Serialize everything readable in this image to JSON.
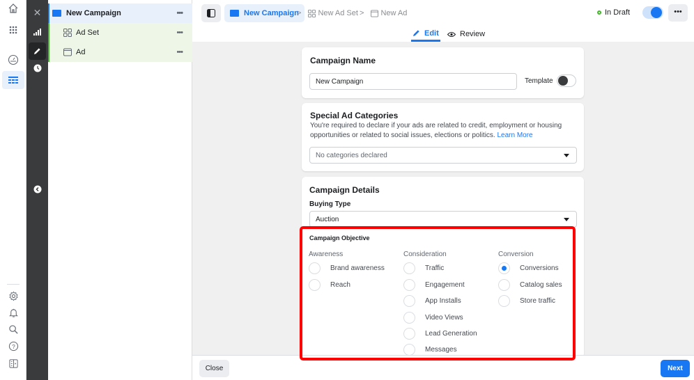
{
  "left_rail": {
    "top_icons": [
      "home-icon",
      "apps-grid-icon",
      "dashboard-gauge-icon",
      "ads-manager-table-icon"
    ],
    "bottom_icons": [
      "settings-icon",
      "notifications-icon",
      "search-icon",
      "help-icon",
      "panel-icon"
    ]
  },
  "tool_rail": {
    "icons": [
      "close-icon",
      "chart-icon",
      "edit-pencil-icon",
      "history-clock-icon",
      "collapse-chevron-icon"
    ]
  },
  "tree": {
    "campaign": {
      "label": "New Campaign",
      "more": "•••"
    },
    "adset": {
      "label": "Ad Set",
      "more": "•••"
    },
    "ad": {
      "label": "Ad",
      "more": "•••"
    }
  },
  "header": {
    "breadcrumbs": [
      {
        "label": "New Campaign"
      },
      {
        "label": "New Ad Set"
      },
      {
        "label": "New Ad"
      }
    ],
    "separator": ">",
    "status": "In Draft",
    "more": "•••",
    "tabs": [
      {
        "label": "Edit",
        "active": true
      },
      {
        "label": "Review",
        "active": false
      }
    ]
  },
  "campaign_name": {
    "title": "Campaign Name",
    "value": "New Campaign",
    "template_label": "Template"
  },
  "special_ad": {
    "title": "Special Ad Categories",
    "description": "You're required to declare if your ads are related to credit, employment or housing opportunities or related to social issues, elections or politics.",
    "learn_more": "Learn More",
    "dropdown_value": "No categories declared"
  },
  "details": {
    "title": "Campaign Details",
    "buying_type_label": "Buying Type",
    "buying_type_value": "Auction",
    "objective_label": "Campaign Objective",
    "columns": [
      {
        "heading": "Awareness",
        "options": [
          {
            "label": "Brand awareness",
            "selected": false
          },
          {
            "label": "Reach",
            "selected": false
          }
        ]
      },
      {
        "heading": "Consideration",
        "options": [
          {
            "label": "Traffic",
            "selected": false
          },
          {
            "label": "Engagement",
            "selected": false
          },
          {
            "label": "App Installs",
            "selected": false
          },
          {
            "label": "Video Views",
            "selected": false
          },
          {
            "label": "Lead Generation",
            "selected": false
          },
          {
            "label": "Messages",
            "selected": false
          }
        ]
      },
      {
        "heading": "Conversion",
        "options": [
          {
            "label": "Conversions",
            "selected": true
          },
          {
            "label": "Catalog sales",
            "selected": false
          },
          {
            "label": "Store traffic",
            "selected": false
          }
        ]
      }
    ]
  },
  "footer": {
    "close_label": "Close",
    "next_label": "Next"
  },
  "colors": {
    "accent": "#1877f2",
    "draft_status": "#42b72a",
    "highlight": "#ff0000"
  }
}
